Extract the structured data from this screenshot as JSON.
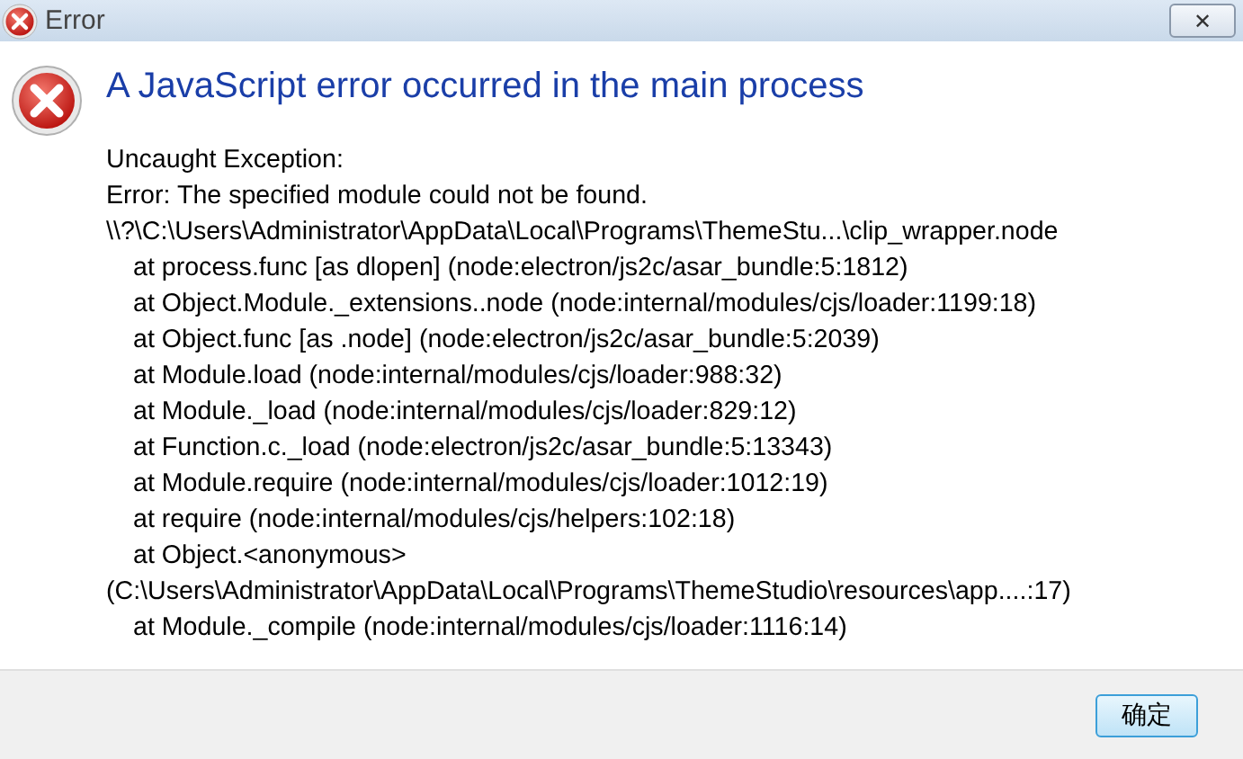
{
  "window": {
    "title": "Error",
    "close_label": "✕"
  },
  "heading": "A JavaScript error occurred in the main process",
  "message_lines": [
    {
      "text": "Uncaught Exception:",
      "indented": false
    },
    {
      "text": "Error: The specified module could not be found.",
      "indented": false
    },
    {
      "text": "\\\\?\\C:\\Users\\Administrator\\AppData\\Local\\Programs\\ThemeStu...\\clip_wrapper.node",
      "indented": false
    },
    {
      "text": "at process.func [as dlopen] (node:electron/js2c/asar_bundle:5:1812)",
      "indented": true
    },
    {
      "text": "at Object.Module._extensions..node (node:internal/modules/cjs/loader:1199:18)",
      "indented": true
    },
    {
      "text": "at Object.func [as .node] (node:electron/js2c/asar_bundle:5:2039)",
      "indented": true
    },
    {
      "text": "at Module.load (node:internal/modules/cjs/loader:988:32)",
      "indented": true
    },
    {
      "text": "at Module._load (node:internal/modules/cjs/loader:829:12)",
      "indented": true
    },
    {
      "text": "at Function.c._load (node:electron/js2c/asar_bundle:5:13343)",
      "indented": true
    },
    {
      "text": "at Module.require (node:internal/modules/cjs/loader:1012:19)",
      "indented": true
    },
    {
      "text": "at require (node:internal/modules/cjs/helpers:102:18)",
      "indented": true
    },
    {
      "text": "at Object.<anonymous>",
      "indented": true
    },
    {
      "text": "(C:\\Users\\Administrator\\AppData\\Local\\Programs\\ThemeStudio\\resources\\app....:17)",
      "indented": false
    },
    {
      "text": "at Module._compile (node:internal/modules/cjs/loader:1116:14)",
      "indented": true
    }
  ],
  "buttons": [
    "确定"
  ]
}
